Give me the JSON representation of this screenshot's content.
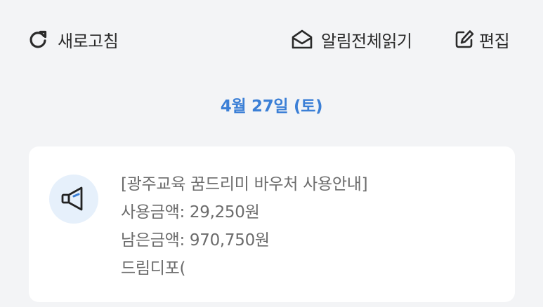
{
  "toolbar": {
    "refresh": {
      "label": "새로고침",
      "icon": "refresh-icon"
    },
    "read_all": {
      "label": "알림전체읽기",
      "icon": "envelope-open-icon"
    },
    "edit": {
      "label": "편집",
      "icon": "edit-icon"
    }
  },
  "date_header": "4월 27일 (토)",
  "notification": {
    "icon": "megaphone-icon",
    "lines": [
      "[광주교육 꿈드리미 바우처 사용안내]",
      "사용금액: 29,250원",
      "남은금액: 970,750원",
      "드림디포("
    ]
  },
  "colors": {
    "background": "#f3f4f6",
    "accent": "#3b7fd6",
    "card": "#ffffff",
    "icon_circle": "#e6f0fb",
    "text_primary": "#2a2a2a",
    "text_secondary": "#6b6b6b"
  }
}
